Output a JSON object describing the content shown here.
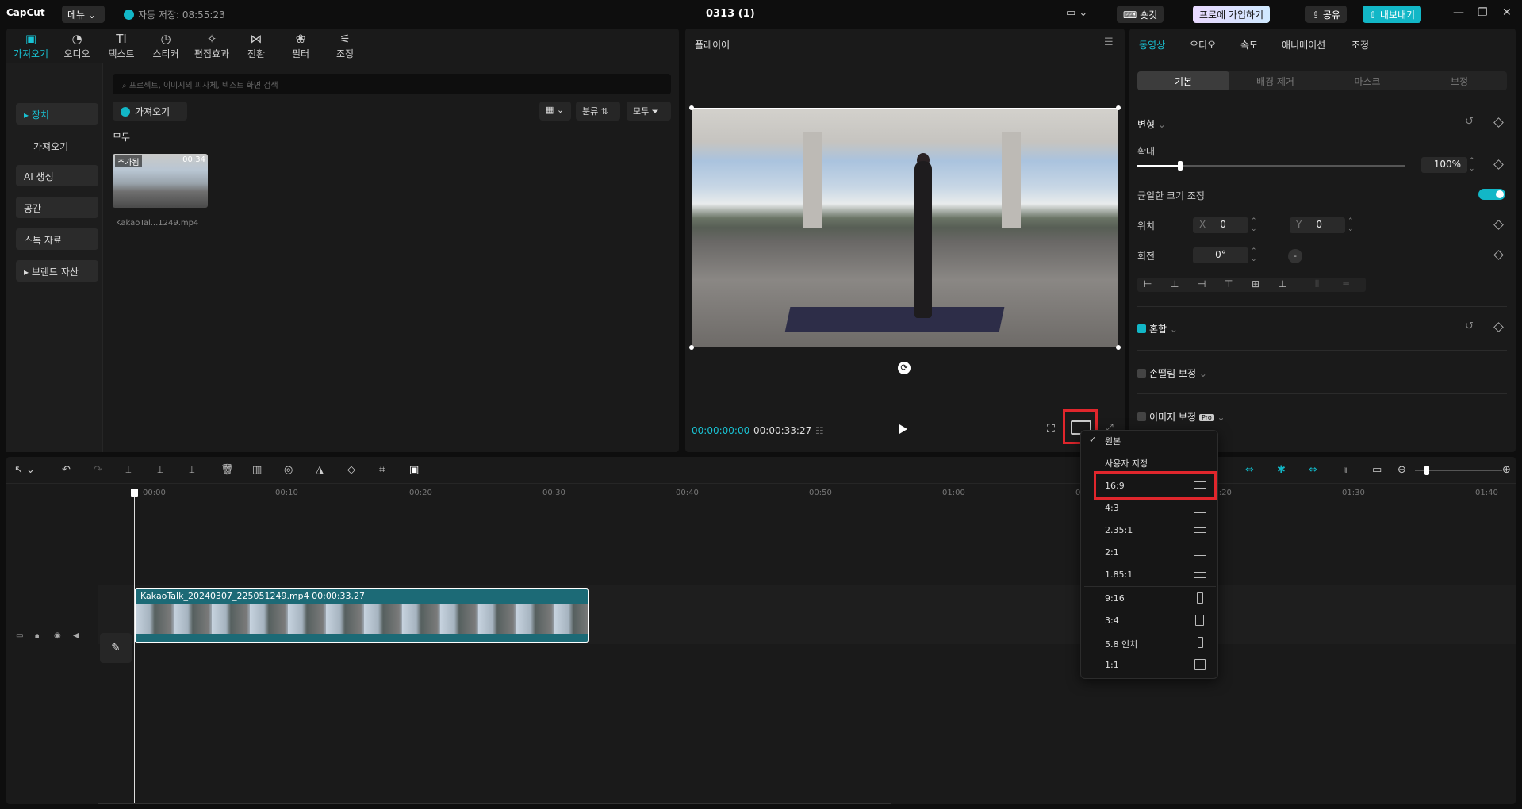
{
  "app": {
    "logo": "CapCut",
    "menu_label": "메뉴",
    "autosave": "자동 저장: 08:55:23",
    "doc_title": "0313 (1)"
  },
  "topbar": {
    "shortcut_label": "숏컷",
    "pro_label": "프로에 가입하기",
    "share_label": "공유",
    "export_label": "내보내기"
  },
  "media": {
    "tabs": [
      {
        "label": "가져오기",
        "icon": "import-icon"
      },
      {
        "label": "오디오",
        "icon": "audio-icon"
      },
      {
        "label": "텍스트",
        "icon": "text-icon"
      },
      {
        "label": "스티커",
        "icon": "sticker-icon"
      },
      {
        "label": "편집효과",
        "icon": "effects-icon"
      },
      {
        "label": "전환",
        "icon": "transition-icon"
      },
      {
        "label": "필터",
        "icon": "filter-icon"
      },
      {
        "label": "조정",
        "icon": "adjust-icon"
      }
    ],
    "nav": [
      "장치",
      "가져오기",
      "AI 생성",
      "공간",
      "스톡 자료",
      "브랜드 자산"
    ],
    "search_placeholder": "프로젝트, 이미지의 피사체, 텍스트 화면 검색",
    "import_label": "가져오기",
    "sort_label": "분류",
    "filter_label": "모두",
    "all_header": "모두",
    "item": {
      "tag": "추가됨",
      "duration": "00:34",
      "name": "KakaoTal...1249.mp4"
    }
  },
  "player": {
    "title": "플레이어",
    "current_time": "00:00:00:00",
    "total_time": "00:00:33:27"
  },
  "props": {
    "tabs": [
      "동영상",
      "오디오",
      "속도",
      "애니메이션",
      "조정"
    ],
    "subtabs": [
      "기본",
      "배경 제거",
      "마스크",
      "보정"
    ],
    "transform_label": "변형",
    "scale_label": "확대",
    "scale_value": "100%",
    "uniform_label": "균일한 크기 조정",
    "position_label": "위치",
    "pos_x_axis": "X",
    "pos_x": "0",
    "pos_y_axis": "Y",
    "pos_y": "0",
    "rotation_label": "회전",
    "rotation_value": "0°",
    "blend_label": "혼합",
    "stabilize_label": "손떨림 보정",
    "enhance_label": "이미지 보정",
    "pro_badge": "Pro",
    "scale_fraction": 0.16
  },
  "timeline": {
    "ticks": [
      "00:00",
      "00:10",
      "00:20",
      "00:30",
      "00:40",
      "00:50",
      "01:00",
      "01:10",
      "01:20",
      "01:30",
      "01:40"
    ],
    "clip_title": "KakaoTalk_20240307_225051249.mp4   00:00:33.27"
  },
  "ratio_menu": {
    "options": [
      {
        "label": "원본",
        "shape": ""
      },
      {
        "label": "사용자 지정",
        "shape": ""
      },
      {
        "label": "16:9",
        "shape": "landscape"
      },
      {
        "label": "4:3",
        "shape": "landscape"
      },
      {
        "label": "2.35:1",
        "shape": "wide"
      },
      {
        "label": "2:1",
        "shape": "wide"
      },
      {
        "label": "1.85:1",
        "shape": "wide"
      },
      {
        "label": "9:16",
        "shape": "portrait"
      },
      {
        "label": "3:4",
        "shape": "portrait"
      },
      {
        "label": "5.8 인치",
        "shape": "portrait"
      },
      {
        "label": "1:1",
        "shape": "square"
      }
    ]
  },
  "colors": {
    "accent": "#12b7c7",
    "highlight": "#e0262c"
  }
}
